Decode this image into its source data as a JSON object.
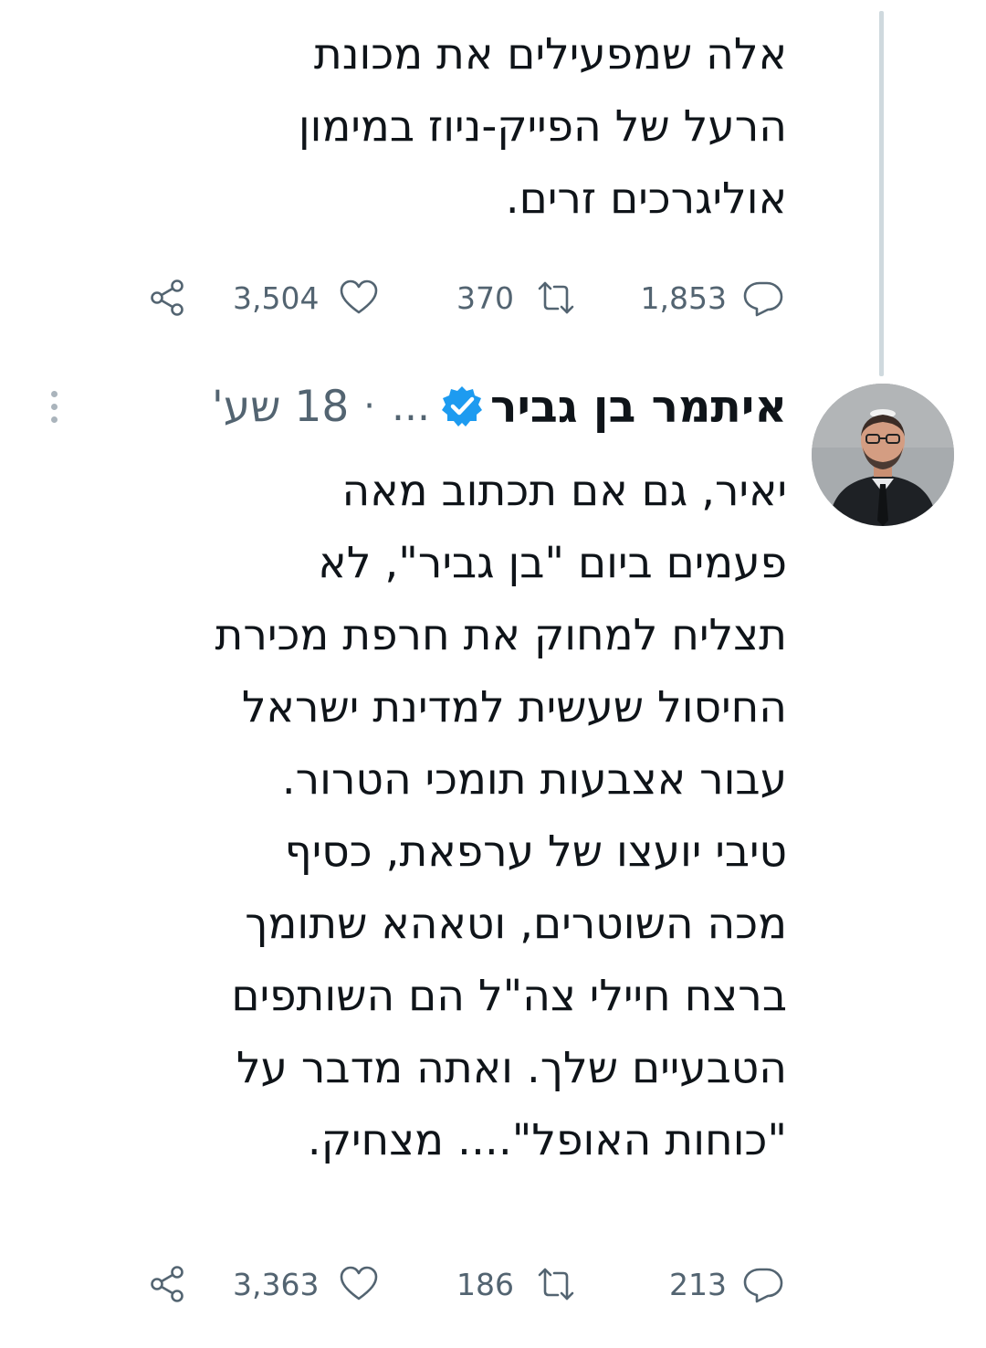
{
  "previous_tweet": {
    "text_lines": [
      "אלה שמפעילים את מכונת",
      "הרעל של הפייק-ניוז במימון",
      "אוליגרכים זרים."
    ],
    "stats": {
      "replies": "1,853",
      "retweets": "370",
      "likes": "3,504"
    }
  },
  "tweet": {
    "author_name": "איתמר בן גביר",
    "handle": "...",
    "separator": "·",
    "time": "18 שע'",
    "verified": true,
    "text_lines": [
      "יאיר, גם אם תכתוב מאה",
      "פעמים ביום \"בן גביר\", לא",
      "תצליח למחוק את חרפת מכירת",
      "החיסול שעשית למדינת ישראל",
      "עבור אצבעות תומכי הטרור.",
      "טיבי יועצו של ערפאת, כסיף",
      "מכה השוטרים, וטאהא שתומך",
      "ברצח חיילי צה\"ל הם השותפים",
      "הטבעיים שלך. ואתה מדבר על",
      "\"כוחות האופל\".... מצחיק."
    ],
    "stats": {
      "replies": "213",
      "retweets": "186",
      "likes": "3,363"
    }
  },
  "icons": {
    "reply": "reply-icon",
    "retweet": "retweet-icon",
    "like": "heart-icon",
    "share": "share-icon",
    "verified": "verified-badge-icon",
    "more": "more-options-icon"
  },
  "colors": {
    "text": "#0f1419",
    "secondary": "#536471",
    "verified": "#1d9bf0",
    "thread_line": "#cfd9de"
  }
}
